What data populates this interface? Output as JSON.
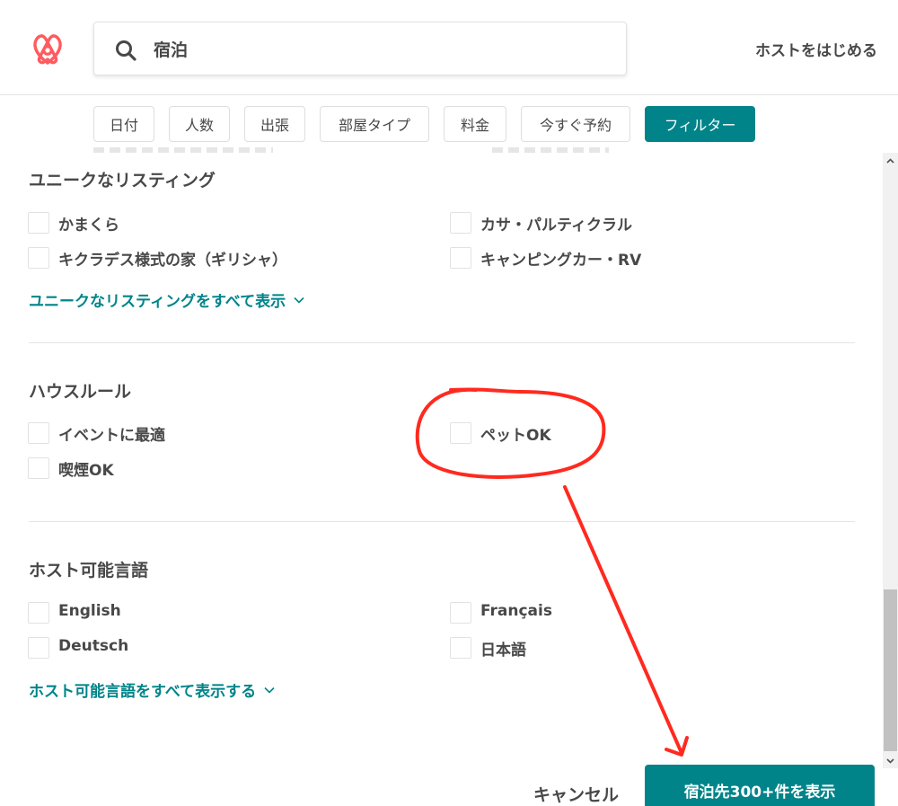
{
  "search": {
    "query": "宿泊"
  },
  "header": {
    "host_link": "ホストをはじめる"
  },
  "filters": [
    "日付",
    "人数",
    "出張",
    "部屋タイプ",
    "料金",
    "今すぐ予約",
    "フィルター"
  ],
  "unique": {
    "title": "ユニークなリスティング",
    "options": [
      "かまくら",
      "カサ・パルティクラル",
      "キクラデス様式の家（ギリシャ）",
      "キャンピングカー・RV"
    ],
    "show_all": "ユニークなリスティングをすべて表示"
  },
  "house_rules": {
    "title": "ハウスルール",
    "options": [
      "イベントに最適",
      "ペットOK",
      "喫煙OK"
    ]
  },
  "languages": {
    "title": "ホスト可能言語",
    "options": [
      "English",
      "Français",
      "Deutsch",
      "日本語"
    ],
    "show_all": "ホスト可能言語をすべて表示する"
  },
  "footer": {
    "cancel": "キャンセル",
    "show_button": "宿泊先300+件を表示"
  },
  "colors": {
    "brand": "#FF5A5F",
    "accent": "#008489",
    "annotation": "#FF2A1F"
  },
  "icons": {
    "logo": "airbnb-logo-icon",
    "search": "search-icon",
    "chevron": "chevron-down-icon"
  }
}
